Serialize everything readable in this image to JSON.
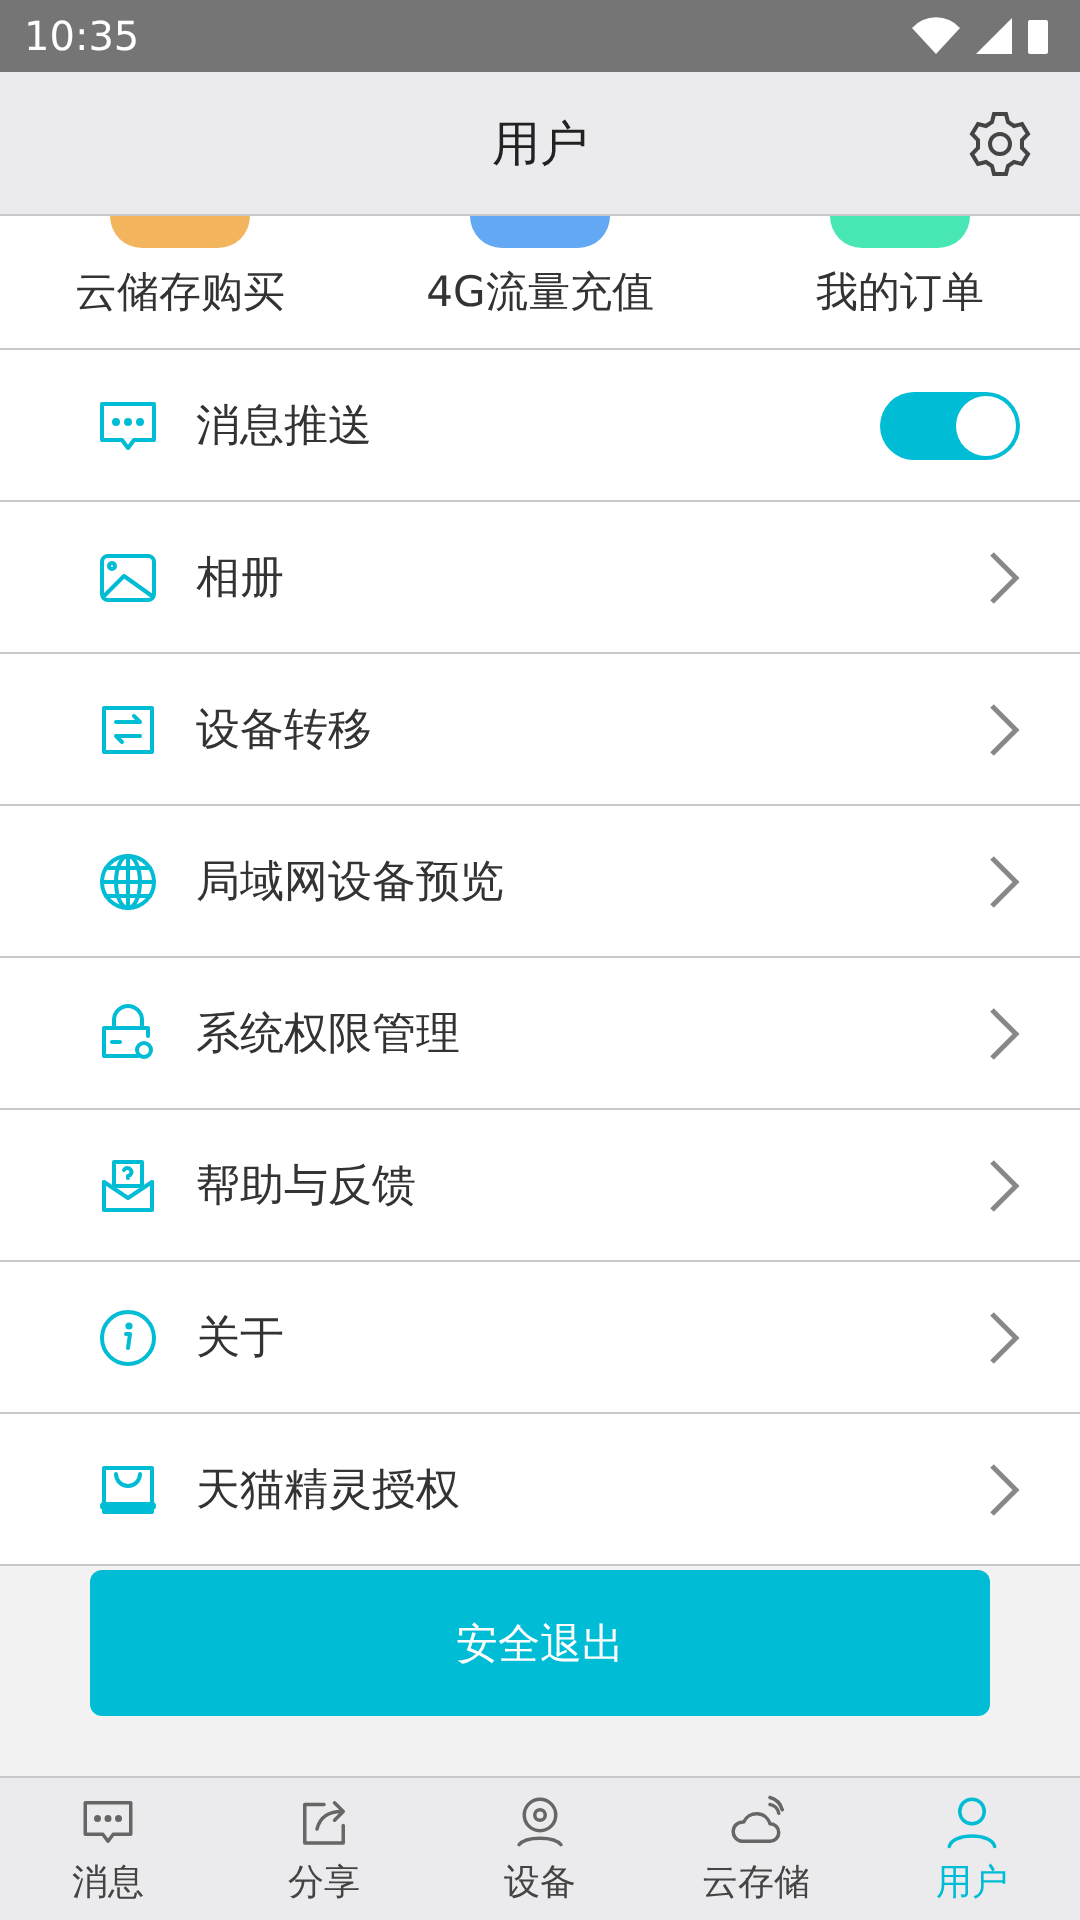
{
  "status_bar": {
    "time": "10:35"
  },
  "header": {
    "title": "用户"
  },
  "shortcuts": [
    {
      "label": "云储存购买",
      "color": "#f2b55e"
    },
    {
      "label": "4G流量充值",
      "color": "#63a8f2"
    },
    {
      "label": "我的订单",
      "color": "#48e6b4"
    }
  ],
  "menu": [
    {
      "kind": "toggle",
      "label": "消息推送",
      "on": true
    },
    {
      "kind": "link",
      "label": "相册"
    },
    {
      "kind": "link",
      "label": "设备转移"
    },
    {
      "kind": "link",
      "label": "局域网设备预览"
    },
    {
      "kind": "link",
      "label": "系统权限管理"
    },
    {
      "kind": "link",
      "label": "帮助与反馈"
    },
    {
      "kind": "link",
      "label": "关于"
    },
    {
      "kind": "link",
      "label": "天猫精灵授权"
    }
  ],
  "logout_button": "安全退出",
  "tabs": [
    {
      "label": "消息",
      "selected": false
    },
    {
      "label": "分享",
      "selected": false
    },
    {
      "label": "设备",
      "selected": false
    },
    {
      "label": "云存储",
      "selected": false
    },
    {
      "label": "用户",
      "selected": true
    }
  ]
}
